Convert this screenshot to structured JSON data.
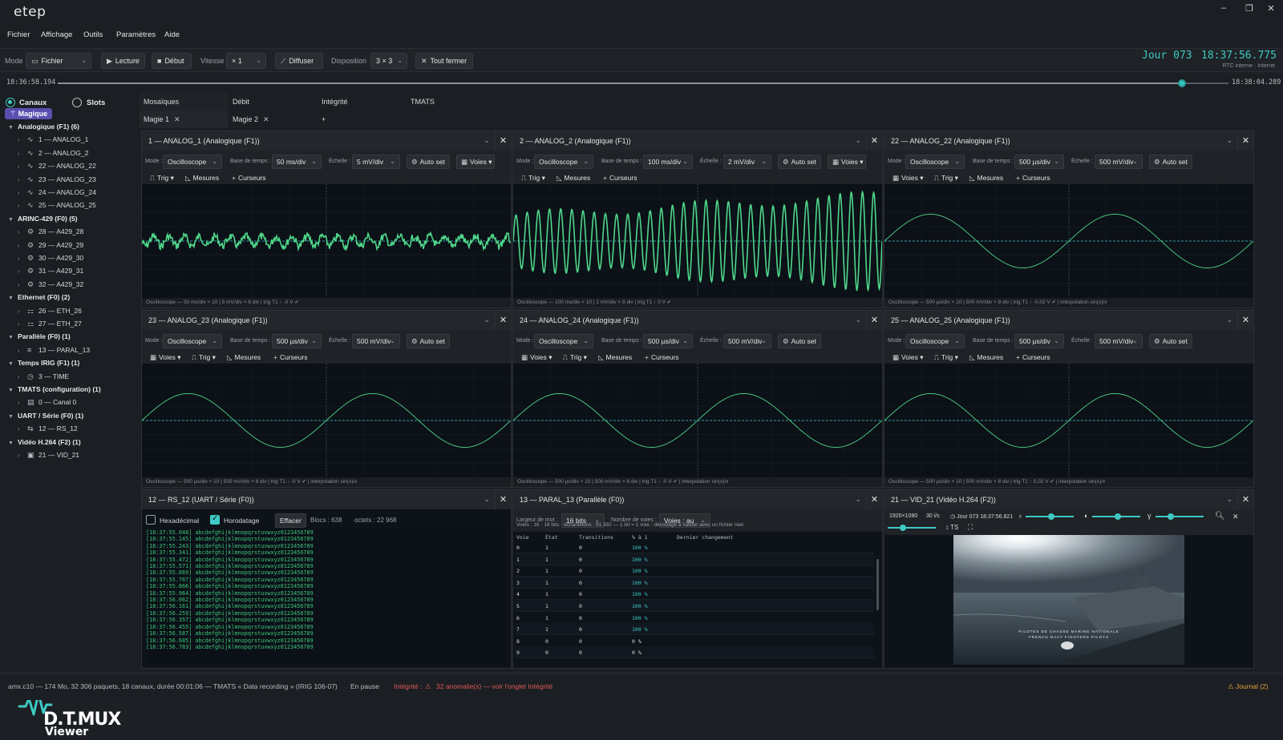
{
  "app": {
    "title": "etep"
  },
  "window": {
    "min": "–",
    "max": "❐",
    "close": "✕"
  },
  "menu": [
    "Fichier",
    "Affichage",
    "Outils",
    "Paramètres",
    "Aide"
  ],
  "toolbar": {
    "mode_label": "Mode",
    "mode_value": "Fichier",
    "play": "Lecture",
    "start": "Début",
    "speed_label": "Vitesse",
    "speed_value": "× 1",
    "broadcast": "Diffuser",
    "layout_label": "Disposition",
    "layout_value": "3 × 3",
    "close_all": "Tout fermer"
  },
  "clock": {
    "day": "Jour 073",
    "time": "18:37:56.775",
    "source": "RTC interne · Interne"
  },
  "timeline": {
    "start": "18:36:58.194",
    "end": "18:38:04.289",
    "position": 0.96
  },
  "sidebar": {
    "mode_channels": "Canaux",
    "mode_slots": "Slots",
    "magic": "Magique",
    "groups": [
      {
        "label": "Analogique (F1)  (6)",
        "items": [
          "1 — ANALOG_1",
          "2 — ANALOG_2",
          "22 — ANALOG_22",
          "23 — ANALOG_23",
          "24 — ANALOG_24",
          "25 — ANALOG_25"
        ],
        "icon": "wave-icon"
      },
      {
        "label": "ARINC-429 (F0)  (5)",
        "items": [
          "28 — A429_28",
          "29 — A429_29",
          "30 — A429_30",
          "31 — A429_31",
          "32 — A429_32"
        ],
        "icon": "gear-icon"
      },
      {
        "label": "Ethernet (F0)  (2)",
        "items": [
          "26 — ETH_26",
          "27 — ETH_27"
        ],
        "icon": "network-icon"
      },
      {
        "label": "Parallèle (F0)  (1)",
        "items": [
          "13 — PARAL_13"
        ],
        "icon": "parallel-icon"
      },
      {
        "label": "Temps IRIG (F1)  (1)",
        "items": [
          "3 — TIME"
        ],
        "icon": "clock-icon"
      },
      {
        "label": "TMATS (configuration)  (1)",
        "items": [
          "0 — Canal 0"
        ],
        "icon": "document-icon"
      },
      {
        "label": "UART / Série (F0)  (1)",
        "items": [
          "12 — RS_12"
        ],
        "icon": "serial-icon"
      },
      {
        "label": "Vidéo H.264 (F2)  (1)",
        "items": [
          "21 — VID_21"
        ],
        "icon": "video-icon"
      }
    ],
    "logo": {
      "name": "D.T.MUX",
      "sub": "Viewer"
    }
  },
  "tabs": {
    "headers": [
      "Mosaïques",
      "Débit",
      "Intégrité",
      "TMATS"
    ],
    "mosaics": [
      "Magie 1",
      "Magie 2"
    ],
    "add": "+"
  },
  "labels": {
    "mode": "Mode :",
    "timebase": "Base de temps :",
    "scale": "Échelle :",
    "autoset": "Auto set",
    "channels": "Voies",
    "trig": "Trig",
    "measures": "Mesures",
    "cursors": "Curseurs",
    "scope": "Oscilloscope"
  },
  "panels": [
    {
      "title": "1 — ANALOG_1 (Analogique (F1))",
      "timebase": "50 ms/div",
      "scale": "5 mV/div",
      "footer": "Oscilloscope — 50 ms/div × 10   |   5 mV/div × 8 div   |   trig T1 ↑ -0 V ✔"
    },
    {
      "title": "2 — ANALOG_2 (Analogique (F1))",
      "timebase": "100 ms/div",
      "scale": "2 mV/div",
      "footer": "Oscilloscope — 100 ms/div × 10   |   2 mV/div × 8 div   |   trig T1 ↑ 0 V ✔"
    },
    {
      "title": "22 — ANALOG_22 (Analogique (F1))",
      "timebase": "500 µs/div",
      "scale": "500 mV/div",
      "footer": "Oscilloscope — 500 µs/div × 10   |   500 mV/div × 8 div   |   trig T1 ↑ -0,02 V ✔   |   interpolation sin(x)/x"
    },
    {
      "title": "23 — ANALOG_23 (Analogique (F1))",
      "timebase": "500 µs/div",
      "scale": "500 mV/div",
      "footer": "Oscilloscope — 500 µs/div × 10   |   500 mV/div × 8 div   |   trig T1 ↑ -0 V ✔   |   interpolation sin(x)/x"
    },
    {
      "title": "24 — ANALOG_24 (Analogique (F1))",
      "timebase": "500 µs/div",
      "scale": "500 mV/div",
      "footer": "Oscilloscope — 500 µs/div × 10   |   500 mV/div × 8 div   |   trig T1 ↑ -0 V ✔   |   interpolation sin(x)/x"
    },
    {
      "title": "25 — ANALOG_25 (Analogique (F1))",
      "timebase": "500 µs/div",
      "scale": "500 mV/div",
      "footer": "Oscilloscope — 500 µs/div × 10   |   500 mV/div × 8 div   |   trig T1 ↑ 0,02 V ✔   |   interpolation sin(x)/x"
    }
  ],
  "serial": {
    "title": "12 — RS_12 (UART / Série (F0))",
    "hex": "Hexadécimal",
    "timestamp": "Horodatage",
    "clear": "Effacer",
    "blocks": "Blocs : 638",
    "bytes": "octets : 22 968",
    "lines": [
      "[18:37:55.048] abcdefghijklmnopqrstuvwxyz0123456789",
      "[18:37:55.145] abcdefghijklmnopqrstuvwxyz0123456789",
      "[18:37:55.243] abcdefghijklmnopqrstuvwxyz0123456789",
      "[18:37:55.341] abcdefghijklmnopqrstuvwxyz0123456789",
      "[18:37:55.472] abcdefghijklmnopqrstuvwxyz0123456789",
      "[18:37:55.571] abcdefghijklmnopqrstuvwxyz0123456789",
      "[18:37:55.669] abcdefghijklmnopqrstuvwxyz0123456789",
      "[18:37:55.767] abcdefghijklmnopqrstuvwxyz0123456789",
      "[18:37:55.866] abcdefghijklmnopqrstuvwxyz0123456789",
      "[18:37:55.964] abcdefghijklmnopqrstuvwxyz0123456789",
      "[18:37:56.062] abcdefghijklmnopqrstuvwxyz0123456789",
      "[18:37:56.161] abcdefghijklmnopqrstuvwxyz0123456789",
      "[18:37:56.259] abcdefghijklmnopqrstuvwxyz0123456789",
      "[18:37:56.357] abcdefghijklmnopqrstuvwxyz0123456789",
      "[18:37:56.455] abcdefghijklmnopqrstuvwxyz0123456789",
      "[18:37:56.587] abcdefghijklmnopqrstuvwxyz0123456789",
      "[18:37:56.685] abcdefghijklmnopqrstuvwxyz0123456789",
      "[18:37:56.783] abcdefghijklmnopqrstuvwxyz0123456789"
    ]
  },
  "parallel": {
    "title": "13 — PARAL_13 (Parallèle (F0))",
    "word_label": "Largeur de mot :",
    "word_value": "16 bits",
    "voices_label": "Nombre de voies :",
    "voices_value": "Voies : au",
    "info": "Voies : 16 · 16 bits · échantillons : 91 392 — 1 bit = 1 voie ; décodage à valider avec un fichier réel.",
    "columns": [
      "Voie",
      "État",
      "Transitions",
      "% à 1",
      "Dernier changement"
    ],
    "rows": [
      [
        "0",
        "1",
        "0",
        "100 %"
      ],
      [
        "1",
        "1",
        "0",
        "100 %"
      ],
      [
        "2",
        "1",
        "0",
        "100 %"
      ],
      [
        "3",
        "1",
        "0",
        "100 %"
      ],
      [
        "4",
        "1",
        "0",
        "100 %"
      ],
      [
        "5",
        "1",
        "0",
        "100 %"
      ],
      [
        "6",
        "1",
        "0",
        "100 %"
      ],
      [
        "7",
        "1",
        "0",
        "100 %"
      ],
      [
        "8",
        "0",
        "0",
        "0 %"
      ],
      [
        "9",
        "0",
        "0",
        "0 %"
      ]
    ]
  },
  "video": {
    "title": "21 — VID_21 (Vidéo H.264 (F2))",
    "resolution": "1920×1080",
    "fps": "30 i/s",
    "time": "Jour 073   18:37:56.821",
    "ts": "TS",
    "caption1": "PILOTES DE CHASSE MARINE NATIONALE",
    "caption2": "FRENCH NAVY FIGHTERS PILOTS"
  },
  "status": {
    "file": "amx.c10 — 174 Mo, 32 306 paquets, 18 canaux, durée 00:01:06 — TMATS « Data recording » (IRIG 106-07)",
    "state": "En pause",
    "integrity_label": "Intégrité :",
    "integrity_msg": "32 anomalie(s) — voir l'onglet Intégrité",
    "journal": "Journal (2)"
  },
  "colors": {
    "accent": "#3ec9c4",
    "trace": "#4fd68a",
    "warning": "#e05a5a",
    "amber": "#e6a23c"
  }
}
